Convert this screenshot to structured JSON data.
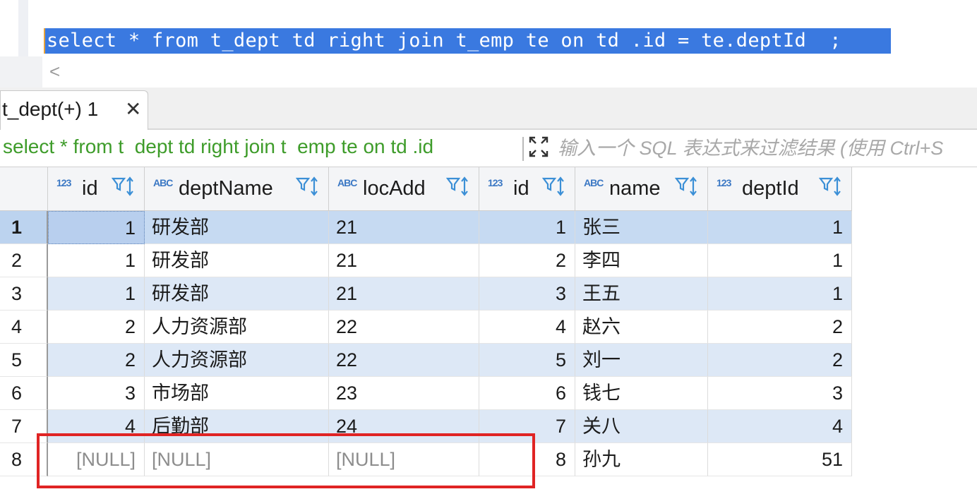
{
  "editor": {
    "sql": "select * from t_dept td right join t_emp te on td .id = te.deptId  ;"
  },
  "scroll_left_glyph": "<",
  "results_tab": {
    "label": "t_dept(+) 1",
    "close_glyph": "✕"
  },
  "filter": {
    "query_text": "select * from t  dept td right join t  emp te on td .id",
    "placeholder": "输入一个 SQL 表达式来过滤结果 (使用 Ctrl+S",
    "expand_icon": "expand-icon"
  },
  "grid": {
    "columns": [
      {
        "type_badge": "123",
        "label": "id",
        "align": "num"
      },
      {
        "type_badge": "ABC",
        "label": "deptName",
        "align": "txt"
      },
      {
        "type_badge": "ABC",
        "label": "locAdd",
        "align": "txt"
      },
      {
        "type_badge": "123",
        "label": "id",
        "align": "num"
      },
      {
        "type_badge": "ABC",
        "label": "name",
        "align": "txt"
      },
      {
        "type_badge": "123",
        "label": "deptId",
        "align": "num"
      }
    ],
    "rows": [
      {
        "n": "1",
        "cells": [
          "1",
          "研发部",
          "21",
          "1",
          "张三",
          "1"
        ]
      },
      {
        "n": "2",
        "cells": [
          "1",
          "研发部",
          "21",
          "2",
          "李四",
          "1"
        ]
      },
      {
        "n": "3",
        "cells": [
          "1",
          "研发部",
          "21",
          "3",
          "王五",
          "1"
        ]
      },
      {
        "n": "4",
        "cells": [
          "2",
          "人力资源部",
          "22",
          "4",
          "赵六",
          "2"
        ]
      },
      {
        "n": "5",
        "cells": [
          "2",
          "人力资源部",
          "22",
          "5",
          "刘一",
          "2"
        ]
      },
      {
        "n": "6",
        "cells": [
          "3",
          "市场部",
          "23",
          "6",
          "钱七",
          "3"
        ]
      },
      {
        "n": "7",
        "cells": [
          "4",
          "后勤部",
          "24",
          "7",
          "关八",
          "4"
        ]
      },
      {
        "n": "8",
        "cells": [
          "[NULL]",
          "[NULL]",
          "[NULL]",
          "8",
          "孙九",
          "51"
        ]
      }
    ],
    "selected_row": 1,
    "null_text": "[NULL]"
  },
  "colors": {
    "selection": "#3a79e0",
    "filter_text": "#3e9c2a",
    "highlight_box": "#e02424",
    "alt_row": "#dde8f6"
  }
}
